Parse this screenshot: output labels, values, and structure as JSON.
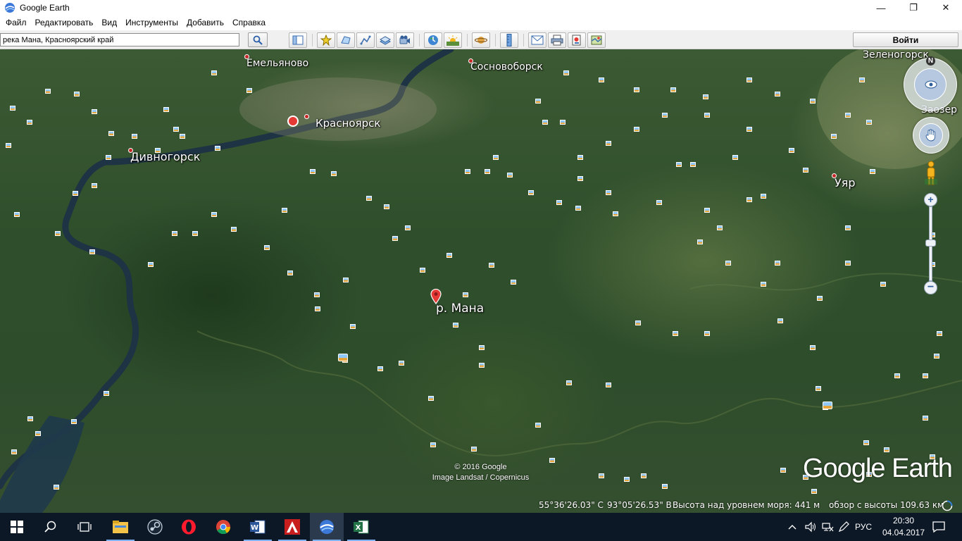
{
  "window": {
    "title": "Google Earth",
    "minimize_glyph": "—",
    "maximize_glyph": "❐",
    "close_glyph": "✕"
  },
  "menu": [
    "Файл",
    "Редактировать",
    "Вид",
    "Инструменты",
    "Добавить",
    "Справка"
  ],
  "toolbar": {
    "search_value": "река Мана, Красноярский край",
    "signin_label": "Войти",
    "icons": [
      "sidebar-toggle-icon",
      "placemark-icon",
      "polygon-icon",
      "path-icon",
      "overlay-icon",
      "tour-icon",
      "historical-imagery-icon",
      "sunlight-icon",
      "planets-icon",
      "ruler-icon",
      "email-icon",
      "print-icon",
      "save-image-icon",
      "maps-view-icon"
    ]
  },
  "map": {
    "places": {
      "emelyanovo": "Емельяново",
      "sosnovoborsk": "Сосновоборск",
      "krasnoyarsk": "Красноярск",
      "divnogorsk": "Дивногорск",
      "zelenogorsk": "Зеленогорск",
      "zaozerny": "Заозер",
      "uyar": "Уяр",
      "mana": "р. Мана"
    },
    "compass_letter": "N",
    "copyright_line1": "© 2016 Google",
    "copyright_line2": "Image Landsat / Copernicus",
    "logo_text": "Google Earth",
    "status": {
      "lat": "55°36'26.03\" С",
      "lon": "93°05'26.53\" В",
      "elevation": "Высота над уровнем моря:   441 м",
      "eye_alt": "обзор с высоты 109.63 км"
    }
  },
  "taskbar": {
    "apps": [
      "start-icon",
      "search-icon",
      "task-view-icon",
      "file-explorer-icon",
      "steam-icon",
      "opera-icon",
      "chrome-icon",
      "word-icon",
      "autocad-icon",
      "google-earth-icon",
      "excel-icon"
    ],
    "language": "РУС",
    "time": "20:30",
    "date": "04.04.2017"
  },
  "colors": {
    "accent_taskbar": "#0d1826",
    "placemark_red": "#e53935",
    "place_dot": "#c62828"
  }
}
